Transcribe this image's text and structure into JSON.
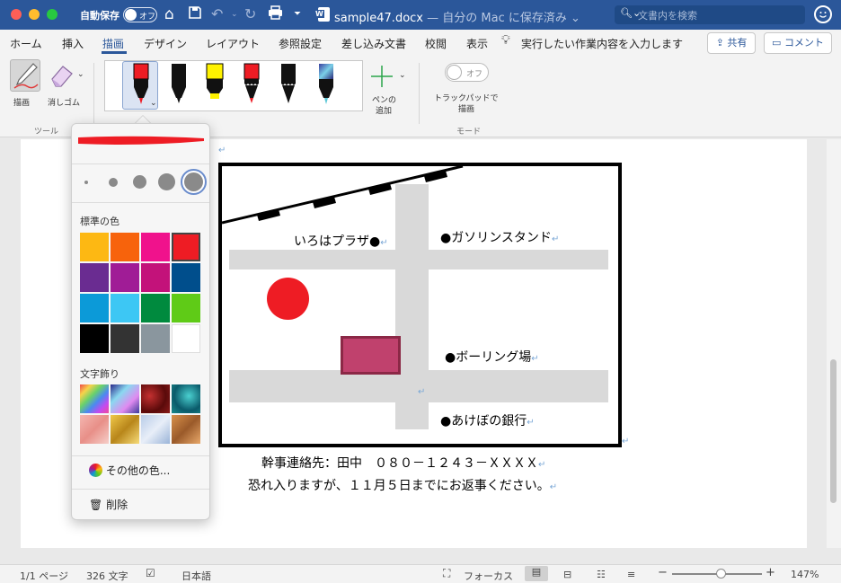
{
  "titlebar": {
    "autosave_label": "自動保存",
    "autosave_state": "オフ",
    "filename": "sample47.docx",
    "location": "— 自分の Mac に保存済み",
    "search_placeholder": "文書内を検索"
  },
  "tabs": [
    "ホーム",
    "挿入",
    "描画",
    "デザイン",
    "レイアウト",
    "参照設定",
    "差し込み文書",
    "校閲",
    "表示"
  ],
  "active_tab": "描画",
  "tell_me": "実行したい作業内容を入力します",
  "share_label": "共有",
  "comment_label": "コメント",
  "ribbon": {
    "draw_label": "描画",
    "eraser_label": "消しゴム",
    "tools_group": "ツール",
    "add_pen_label_1": "ペンの",
    "add_pen_label_2": "追加",
    "trackpad_label_1": "トラックパッドで",
    "trackpad_label_2": "描画",
    "trackpad_state": "オフ",
    "mode_group": "モード"
  },
  "popup": {
    "standard_colors_label": "標準の色",
    "text_effects_label": "文字飾り",
    "more_colors": "その他の色...",
    "delete": "削除",
    "standard_colors": [
      "#fdb813",
      "#f7630c",
      "#f0128c",
      "#ee1c24",
      "#6a2c91",
      "#a01c96",
      "#c3127a",
      "#004e8c",
      "#0c9ad8",
      "#3dc7f4",
      "#008a3e",
      "#5fcb17",
      "#000000",
      "#333333",
      "#8a969e",
      "#ffffff"
    ],
    "selected_color": "#ee1c24"
  },
  "map": {
    "plaza": "いろはプラザ●",
    "gas": "●ガソリンスタンド",
    "bowling": "●ボーリング場",
    "bank": "●あけぼの銀行"
  },
  "body": {
    "line1": "幹事連絡先：田中　０８０－１２４３－ＸＸＸＸ",
    "line2": "恐れ入りますが、１１月５日までにお返事ください。"
  },
  "status": {
    "page": "1/1 ページ",
    "words": "326 文字",
    "language": "日本語",
    "focus": "フォーカス",
    "zoom": "147%"
  }
}
